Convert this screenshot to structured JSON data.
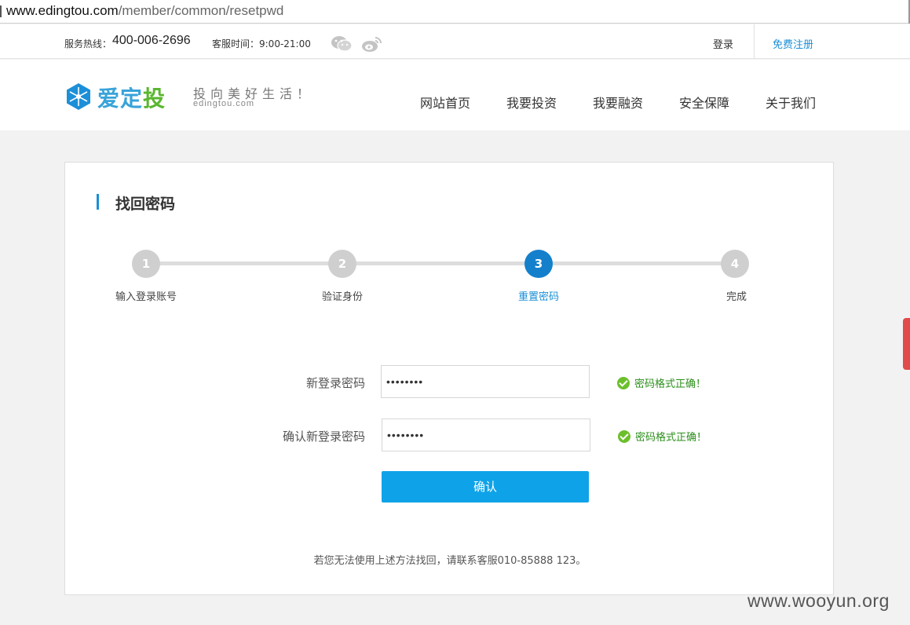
{
  "browser": {
    "url_host": "www.edingtou.com",
    "url_path": "/member/common/resetpwd"
  },
  "topbar": {
    "hotline_label": "服务热线：",
    "hotline_number": "400-006-2696",
    "service_time": "客服时间：9:00-21:00",
    "login": "登录",
    "register": "免费注册"
  },
  "header": {
    "logo_blue": "爱定",
    "logo_green": "投",
    "slogan": "投向美好生活！",
    "slogan_sub": "edingtou.com",
    "nav": [
      "网站首页",
      "我要投资",
      "我要融资",
      "安全保障",
      "关于我们"
    ]
  },
  "card": {
    "title": "找回密码",
    "steps": [
      {
        "num": "1",
        "label": "输入登录账号"
      },
      {
        "num": "2",
        "label": "验证身份"
      },
      {
        "num": "3",
        "label": "重置密码"
      },
      {
        "num": "4",
        "label": "完成"
      }
    ],
    "active_step": 3,
    "form": {
      "new_label": "新登录密码",
      "new_value": "••••••••",
      "confirm_label": "确认新登录密码",
      "confirm_value": "••••••••",
      "valid_msg": "密码格式正确！"
    },
    "confirm_button": "确认",
    "help": "若您无法使用上述方法找回，请联系客服010-85888 123。"
  },
  "watermark": "www.wooyun.org",
  "colors": {
    "accent": "#1480cc",
    "button": "#0ea3e8",
    "success": "#2b8f1b"
  }
}
